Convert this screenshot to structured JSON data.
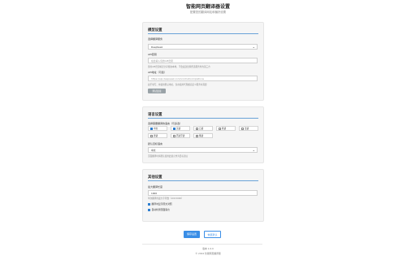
{
  "header": {
    "title": "智能网页翻译器设置",
    "subtitle": "配置您的翻译网站和偏好设置"
  },
  "model_section": {
    "title": "模型设置",
    "provider_label": "选择翻译服务",
    "provider_value": "DeepSeek",
    "api_key_label": "API密钥",
    "api_key_placeholder": "在此输入您的API密钥",
    "api_key_hint": "您的API密钥将安全存储在本地，不会发送给除所选服务外的第三方",
    "api_url_label": "API地址（可选）",
    "api_url_placeholder": "https://api.deepseek.com/v1/chat/completions",
    "api_url_hint": "如不填写，将使用默认地址，仅在使用代理或自定义服务时需要",
    "test_button": "测试连接"
  },
  "language_section": {
    "title": "语言设置",
    "languages_label": "选择需要翻译的语言（可多选）",
    "languages": [
      {
        "name": "中文",
        "checked": true
      },
      {
        "name": "英语",
        "checked": true
      },
      {
        "name": "日语",
        "checked": false
      },
      {
        "name": "韩语",
        "checked": false
      },
      {
        "name": "法语",
        "checked": false
      },
      {
        "name": "德语",
        "checked": false
      },
      {
        "name": "西班牙语",
        "checked": false
      },
      {
        "name": "俄语",
        "checked": false
      }
    ],
    "default_label": "默认目标语言",
    "default_value": "中文",
    "default_hint": "页面翻译时将默认使用此语言作为目标语言"
  },
  "other_section": {
    "title": "其他设置",
    "max_length_label": "最大翻译长度",
    "max_length_value": "1000",
    "max_length_hint": "单次翻译的最大字符数（100-5000）",
    "options": [
      {
        "label": "翻译时显示原文对照",
        "checked": true
      },
      {
        "label": "自动检测页面语言",
        "checked": true
      }
    ]
  },
  "actions": {
    "save": "保存设置",
    "reset": "恢复默认"
  },
  "footer": {
    "version": "版本 1.0.0",
    "copyright": "© 2024 智能网页翻译器"
  },
  "colors": {
    "accent": "#3a8ee6",
    "section_bg": "#f5f5f5",
    "checked": "#2f7fd0"
  }
}
